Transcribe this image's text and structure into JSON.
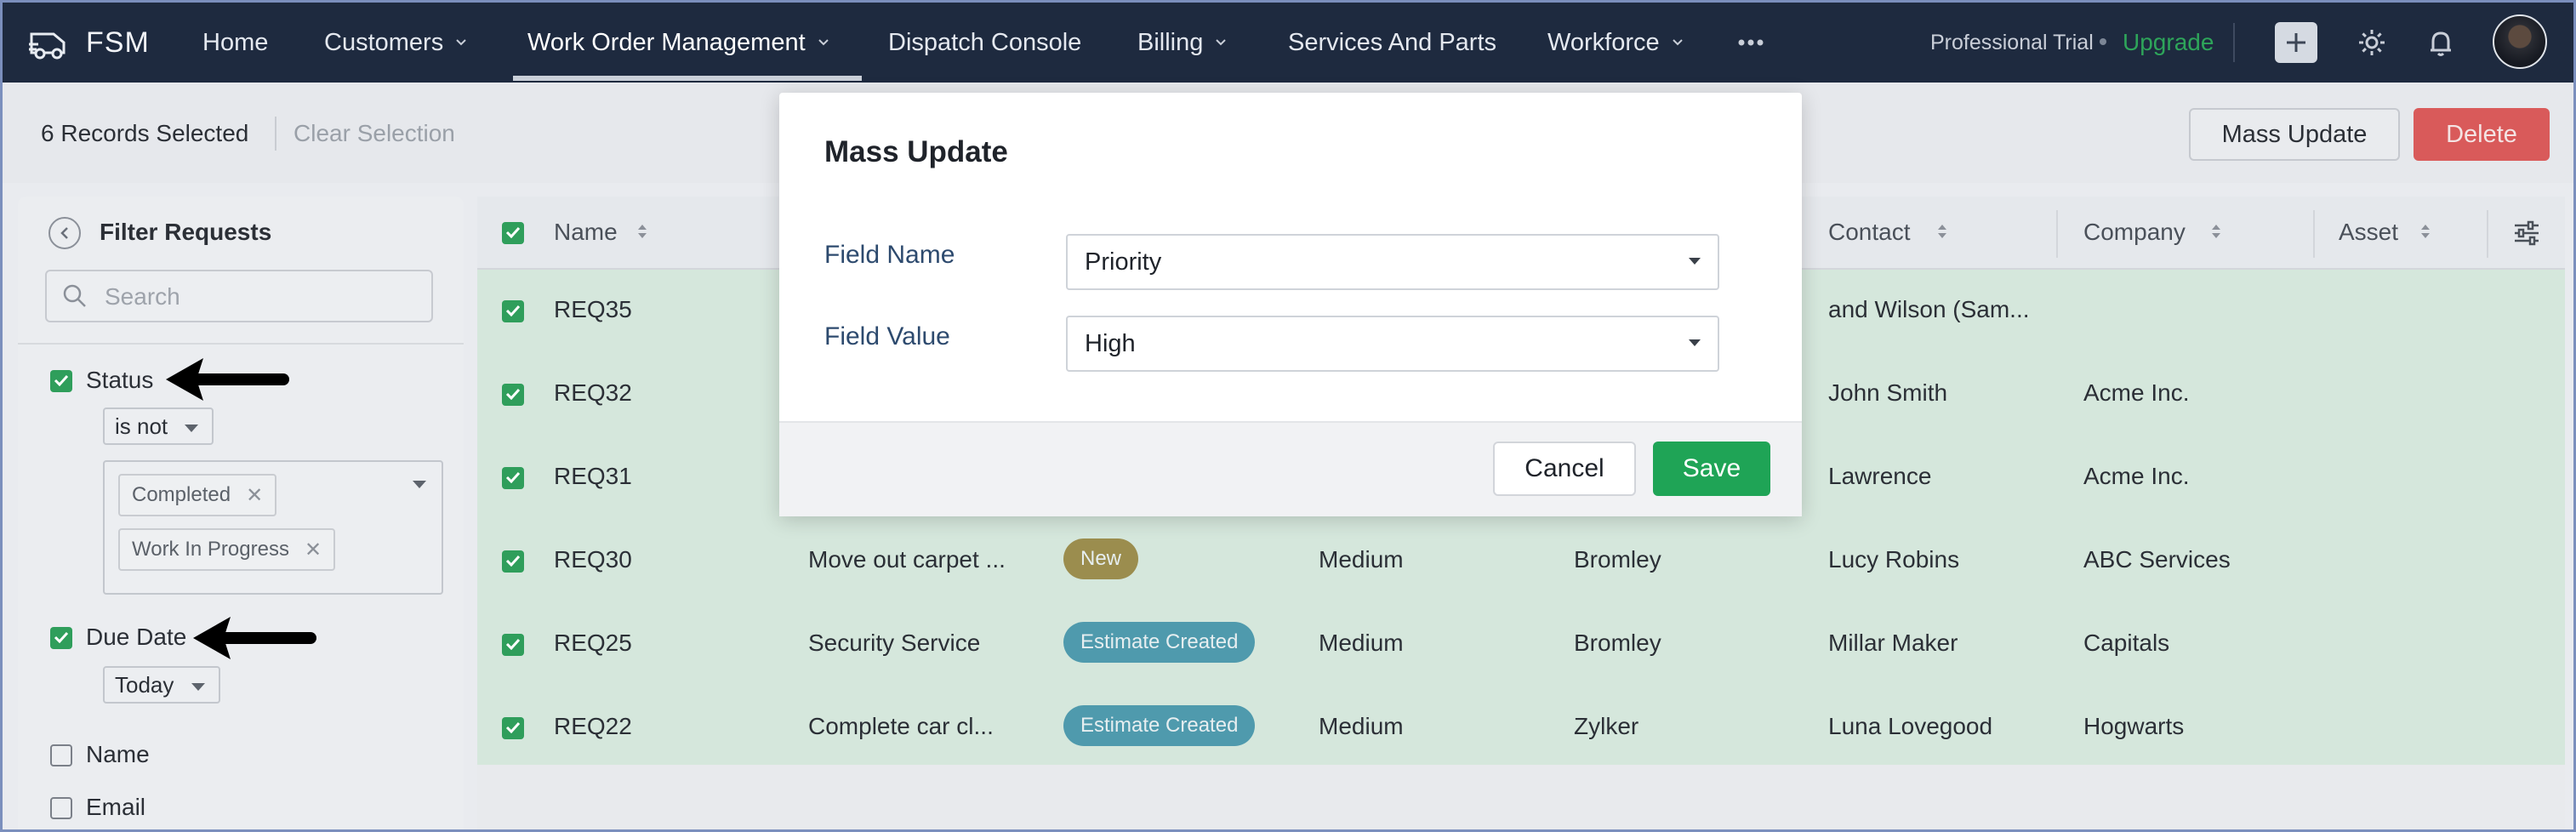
{
  "app": {
    "name": "FSM"
  },
  "nav": {
    "items": [
      {
        "label": "Home"
      },
      {
        "label": "Customers"
      },
      {
        "label": "Work Order Management"
      },
      {
        "label": "Dispatch Console"
      },
      {
        "label": "Billing"
      },
      {
        "label": "Services And Parts"
      },
      {
        "label": "Workforce"
      }
    ],
    "active": "Work Order Management",
    "trial_label": "Professional Trial",
    "upgrade_label": "Upgrade"
  },
  "selection": {
    "count_label": "6 Records Selected",
    "clear_label": "Clear Selection",
    "mass_update_label": "Mass Update",
    "delete_label": "Delete"
  },
  "filter": {
    "title": "Filter Requests",
    "search_placeholder": "Search",
    "status": {
      "label": "Status",
      "checked": true,
      "operator": "is not",
      "tags": [
        "Completed",
        "Work In Progress"
      ]
    },
    "due_date": {
      "label": "Due Date",
      "checked": true,
      "value": "Today"
    },
    "name": {
      "label": "Name",
      "checked": false
    },
    "email": {
      "label": "Email",
      "checked": false
    }
  },
  "grid": {
    "columns": [
      "Name",
      "Contact",
      "Company",
      "Asset"
    ],
    "rows": [
      {
        "id": "REQ35",
        "summary": "",
        "status": "",
        "priority": "",
        "territory": "",
        "contact": "and Wilson (Sam...",
        "company": ""
      },
      {
        "id": "REQ32",
        "summary": "",
        "status": "",
        "priority": "",
        "territory": "",
        "contact": "John Smith",
        "company": "Acme Inc."
      },
      {
        "id": "REQ31",
        "summary": "",
        "status": "",
        "priority": "",
        "territory": "",
        "contact": "Lawrence",
        "company": "Acme Inc."
      },
      {
        "id": "REQ30",
        "summary": "Move out carpet ...",
        "status": "New",
        "priority": "Medium",
        "territory": "Bromley",
        "contact": "Lucy Robins",
        "company": "ABC Services"
      },
      {
        "id": "REQ25",
        "summary": "Security Service",
        "status": "Estimate Created",
        "priority": "Medium",
        "territory": "Bromley",
        "contact": "Millar Maker",
        "company": "Capitals"
      },
      {
        "id": "REQ22",
        "summary": "Complete car cl...",
        "status": "Estimate Created",
        "priority": "Medium",
        "territory": "Zylker",
        "contact": "Luna Lovegood",
        "company": "Hogwarts"
      }
    ]
  },
  "modal": {
    "title": "Mass Update",
    "field_name_label": "Field Name",
    "field_name_value": "Priority",
    "field_value_label": "Field Value",
    "field_value_value": "High",
    "cancel_label": "Cancel",
    "save_label": "Save"
  },
  "colors": {
    "nav_bg": "#1e2a3f",
    "accent_green": "#1fa456",
    "delete_red": "#d95a5a",
    "badge_new": "#9b8d4e",
    "badge_estimate": "#4f9aad"
  }
}
